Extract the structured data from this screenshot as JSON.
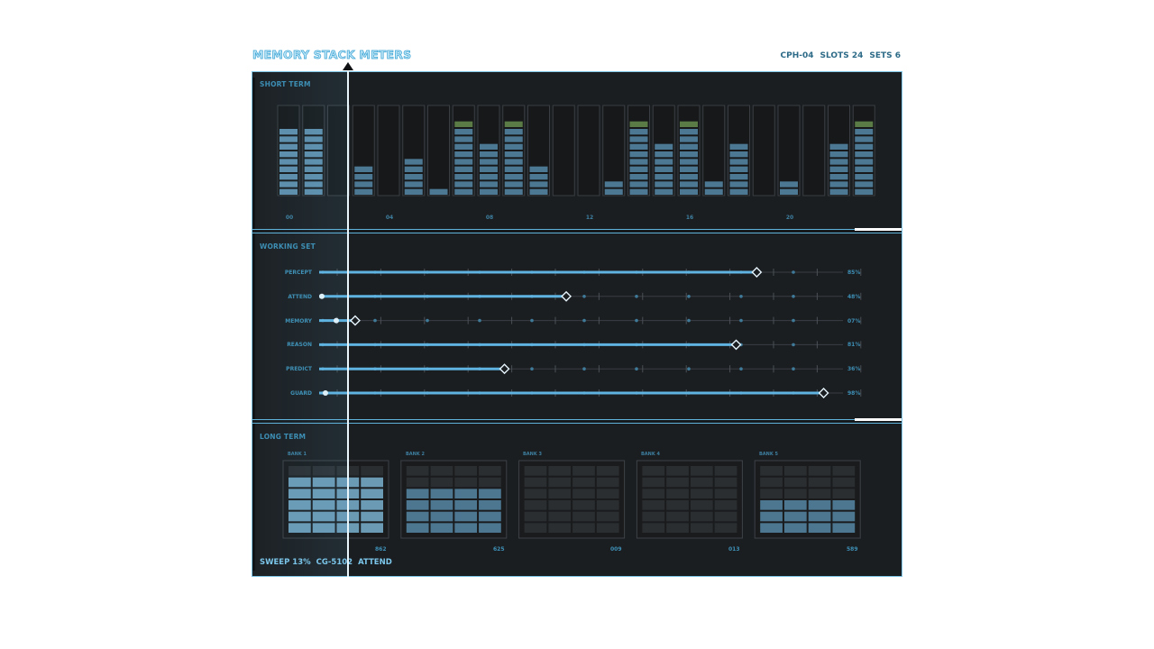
{
  "header": {
    "title": "MEMORY STACK METERS",
    "stats": [
      "CPH-04",
      "SLOTS 24",
      "SETS 6"
    ]
  },
  "short_term": {
    "label": "SHORT TERM",
    "slot_levels": [
      0.75,
      0.75,
      0,
      0.33,
      0,
      0.42,
      0.08,
      0.83,
      0.58,
      0.83,
      0.33,
      0,
      0,
      0.17,
      0.83,
      0.58,
      0.83,
      0.17,
      0.58,
      0,
      0.17,
      0,
      0.58,
      0.83
    ],
    "ticks": [
      "00",
      "04",
      "08",
      "12",
      "16",
      "20"
    ],
    "colors": {
      "fill": "#4d7894",
      "fill_bright": "#5e8eab",
      "peak": "#5a7a46",
      "empty": "#2a2d30"
    }
  },
  "working_set": {
    "label": "WORKING SET",
    "rows": [
      {
        "name": "PERCEPT",
        "value": 0.85,
        "pct": "85%"
      },
      {
        "name": "ATTEND",
        "value": 0.48,
        "pct": "48%"
      },
      {
        "name": "MEMORY",
        "value": 0.07,
        "pct": "07%"
      },
      {
        "name": "REASON",
        "value": 0.81,
        "pct": "81%"
      },
      {
        "name": "PREDICT",
        "value": 0.36,
        "pct": "36%"
      },
      {
        "name": "GUARD",
        "value": 0.98,
        "pct": "98%"
      }
    ]
  },
  "long_term": {
    "label": "LONG TERM",
    "banks": [
      {
        "name": "BANK 1",
        "value": "862",
        "fill_rows": 5
      },
      {
        "name": "BANK 2",
        "value": "625",
        "fill_rows": 4
      },
      {
        "name": "BANK 3",
        "value": "009",
        "fill_rows": 0
      },
      {
        "name": "BANK 4",
        "value": "013",
        "fill_rows": 0
      },
      {
        "name": "BANK 5",
        "value": "589",
        "fill_rows": 3
      }
    ]
  },
  "footer": {
    "sweep": "SWEEP 13%",
    "code": "CG-5102",
    "mode": "ATTEND"
  },
  "sweep_position": 0.13
}
